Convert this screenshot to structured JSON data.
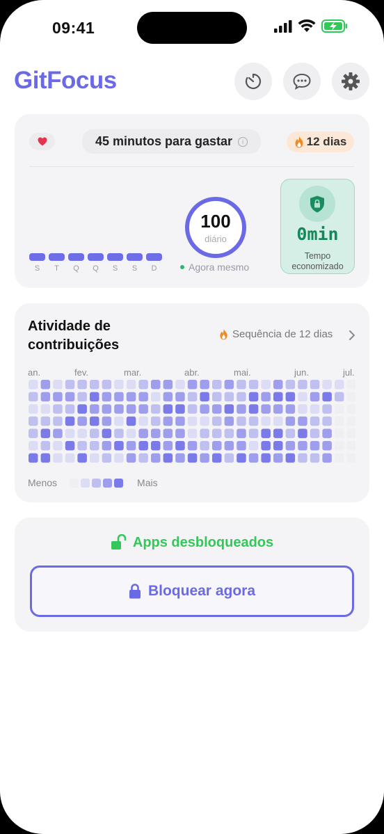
{
  "status_bar": {
    "time": "09:41"
  },
  "app": {
    "title": "GitFocus",
    "accent": "#6b6ae6"
  },
  "header_buttons": [
    {
      "icon": "timer-icon"
    },
    {
      "icon": "chat-icon"
    },
    {
      "icon": "gear-icon"
    }
  ],
  "budget_card": {
    "budget_text": "45 minutos para gastar",
    "streak_text": "12 dias",
    "weekday_labels": [
      "S",
      "T",
      "Q",
      "Q",
      "S",
      "S",
      "D"
    ],
    "score_value": "100",
    "score_label": "diário",
    "updated_text": "Agora mesmo",
    "saved_value": "0min",
    "saved_label": "Tempo economizado"
  },
  "activity_card": {
    "title": "Atividade de contribuições",
    "streak_text": "Sequência de 12 dias",
    "months": [
      "an.",
      "fev.",
      "mar.",
      "abr.",
      "mai.",
      "jun.",
      "jul."
    ],
    "legend_less": "Menos",
    "legend_more": "Mais",
    "level_colors": [
      "#efeff3",
      "#dcdcf4",
      "#c0c0f0",
      "#9e9eec",
      "#7a7ae8"
    ]
  },
  "lock_card": {
    "status_text": "Apps desbloqueados",
    "button_label": "Bloquear agora"
  }
}
